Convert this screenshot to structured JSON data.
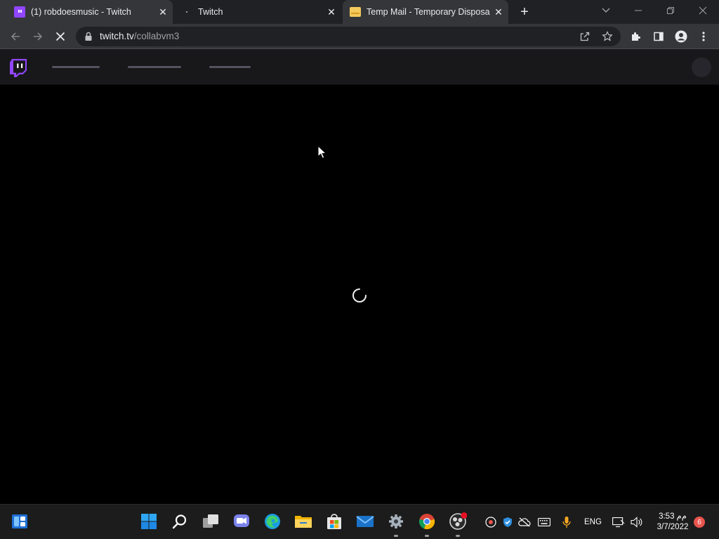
{
  "browser": {
    "tabs": [
      {
        "title": "(1) robdoesmusic - Twitch",
        "favicon": "twitch-icon",
        "active": false
      },
      {
        "title": "Twitch",
        "favicon": "loading-dot",
        "active": false
      },
      {
        "title": "Temp Mail - Temporary Disposab",
        "favicon": "mail-icon",
        "active": true
      }
    ],
    "url_host": "twitch.tv",
    "url_path": "/collabvm3",
    "status": "loading"
  },
  "page": {
    "brand_color": "#9146ff",
    "nav_background": "#18181b",
    "content_state": "loading-spinner"
  },
  "taskbar": {
    "apps": [
      "widgets-icon",
      "start-icon",
      "search-icon",
      "task-view-icon",
      "chat-icon",
      "edge-icon",
      "file-explorer-icon",
      "store-icon",
      "mail-icon",
      "settings-icon",
      "chrome-icon",
      "obs-icon"
    ],
    "language": "ENG",
    "time": "3:53 ﻡﻡ",
    "date": "3/7/2022",
    "notification_count": "6"
  }
}
